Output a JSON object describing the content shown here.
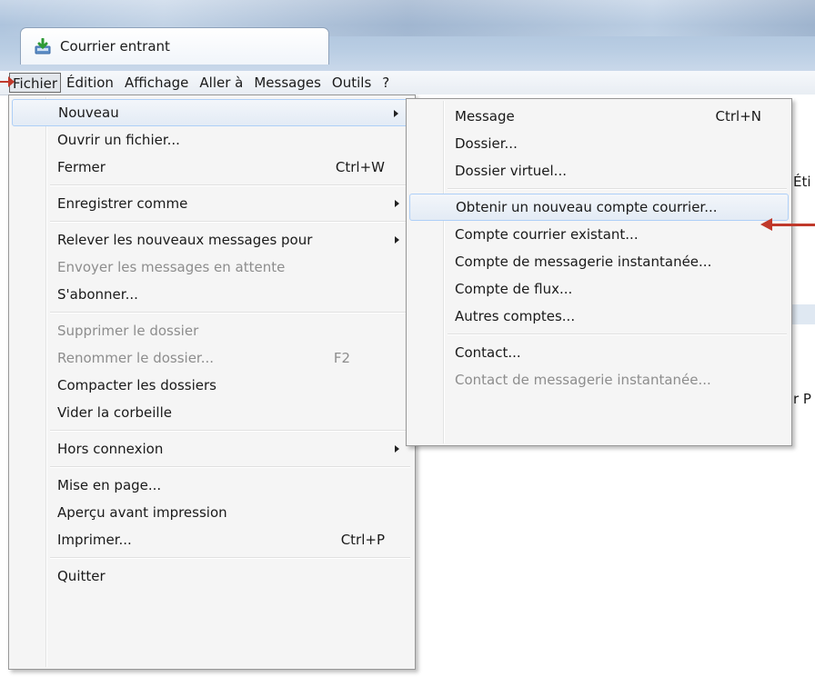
{
  "window": {
    "tab_label": "Courrier entrant"
  },
  "menubar": {
    "items": [
      "Fichier",
      "Édition",
      "Affichage",
      "Aller à",
      "Messages",
      "Outils",
      "?"
    ]
  },
  "background": {
    "text_1": "Éti",
    "text_2": "r P"
  },
  "fichier_menu": {
    "nouveau": "Nouveau",
    "ouvrir": "Ouvrir un fichier...",
    "fermer": "Fermer",
    "fermer_shortcut": "Ctrl+W",
    "enregistrer": "Enregistrer comme",
    "relever": "Relever les nouveaux messages pour",
    "envoyer": "Envoyer les messages en attente",
    "abonner": "S'abonner...",
    "supprimer": "Supprimer le dossier",
    "renommer": "Renommer le dossier...",
    "renommer_shortcut": "F2",
    "compacter": "Compacter les dossiers",
    "vider": "Vider la corbeille",
    "hors_connexion": "Hors connexion",
    "mise_en_page": "Mise en page...",
    "apercu": "Aperçu avant impression",
    "imprimer": "Imprimer...",
    "imprimer_shortcut": "Ctrl+P",
    "quitter": "Quitter"
  },
  "nouveau_submenu": {
    "message": "Message",
    "message_shortcut": "Ctrl+N",
    "dossier": "Dossier...",
    "dossier_virtuel": "Dossier virtuel...",
    "obtenir_compte": "Obtenir un nouveau compte courrier...",
    "compte_existant": "Compte courrier existant...",
    "compte_messagerie": "Compte de messagerie instantanée...",
    "compte_flux": "Compte de flux...",
    "autres_comptes": "Autres comptes...",
    "contact": "Contact...",
    "contact_messagerie": "Contact de messagerie instantanée..."
  },
  "colors": {
    "annotation_arrow": "#c0392b",
    "highlight_border": "#aecff7",
    "disabled_text": "#8d8d8d"
  }
}
